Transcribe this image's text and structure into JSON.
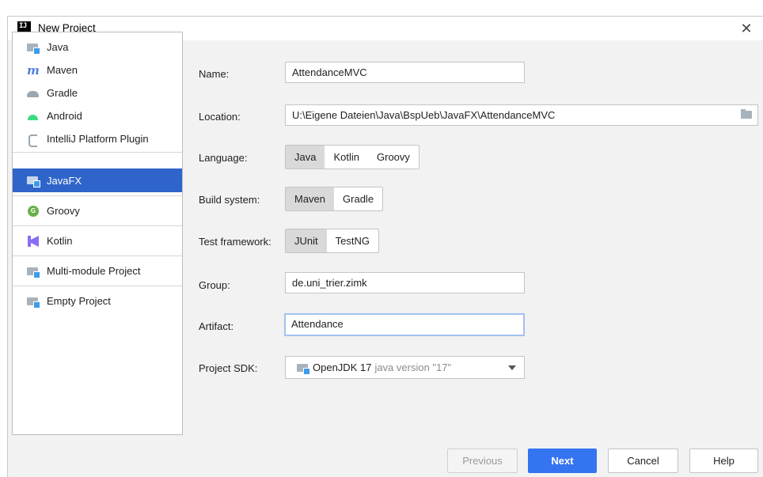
{
  "window": {
    "title": "New Project",
    "close_glyph": "✕",
    "app_icon_text": "IJ"
  },
  "sidebar": {
    "items": [
      {
        "label": "Java",
        "icon": "java-folder-icon"
      },
      {
        "label": "Maven",
        "icon": "maven-icon",
        "glyph": "m"
      },
      {
        "label": "Gradle",
        "icon": "gradle-icon"
      },
      {
        "label": "Android",
        "icon": "android-icon"
      },
      {
        "label": "IntelliJ Platform Plugin",
        "icon": "plugin-icon"
      },
      {
        "label": "JavaFX",
        "icon": "javafx-folder-icon",
        "selected": true
      },
      {
        "label": "Groovy",
        "icon": "groovy-icon"
      },
      {
        "label": "Kotlin",
        "icon": "kotlin-icon"
      },
      {
        "label": "Multi-module Project",
        "icon": "module-folder-icon"
      },
      {
        "label": "Empty Project",
        "icon": "empty-folder-icon"
      }
    ]
  },
  "form": {
    "name": {
      "label": "Name:",
      "value": "AttendanceMVC"
    },
    "location": {
      "label": "Location:",
      "value": "U:\\Eigene Dateien\\Java\\BspUeb\\JavaFX\\AttendanceMVC"
    },
    "language": {
      "label": "Language:",
      "options": [
        "Java",
        "Kotlin",
        "Groovy"
      ],
      "selected": "Java"
    },
    "build_system": {
      "label": "Build system:",
      "options": [
        "Maven",
        "Gradle"
      ],
      "selected": "Maven"
    },
    "test_framework": {
      "label": "Test framework:",
      "options": [
        "JUnit",
        "TestNG"
      ],
      "selected": "JUnit"
    },
    "group": {
      "label": "Group:",
      "value": "de.uni_trier.zimk"
    },
    "artifact": {
      "label": "Artifact:",
      "value": "Attendance"
    },
    "project_sdk": {
      "label": "Project SDK:",
      "name": "OpenJDK 17",
      "version": "java version \"17\""
    }
  },
  "buttons": {
    "previous": "Previous",
    "next": "Next",
    "cancel": "Cancel",
    "help": "Help"
  },
  "colors": {
    "selection": "#2f65ca",
    "primary_button": "#3574f0",
    "focus_border": "#a1c2ee"
  }
}
